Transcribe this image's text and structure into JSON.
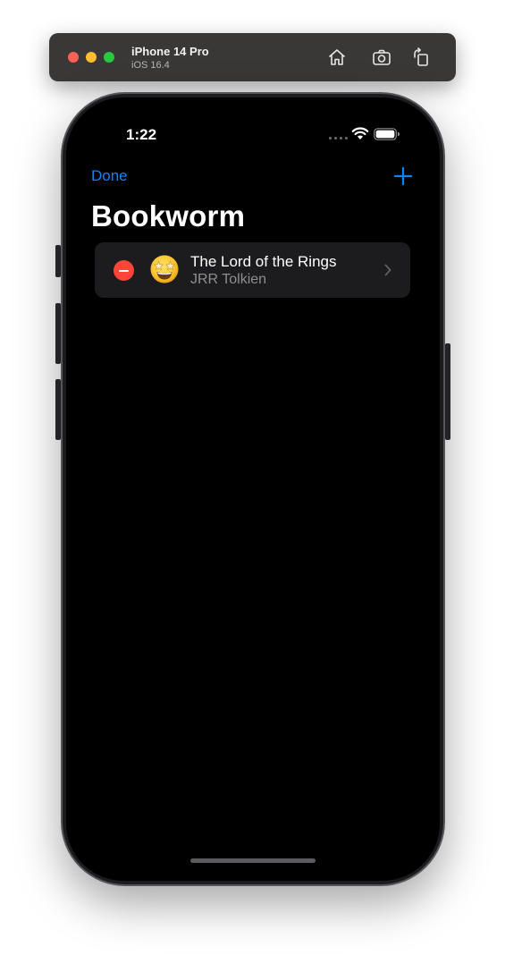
{
  "simulator": {
    "device_name": "iPhone 14 Pro",
    "os_version": "iOS 16.4",
    "toolbar_icons": [
      "home-icon",
      "screenshot-icon",
      "rotate-icon"
    ]
  },
  "status_bar": {
    "time": "1:22"
  },
  "nav": {
    "done_label": "Done",
    "title": "Bookworm",
    "add_icon": "plus-icon"
  },
  "books": [
    {
      "title": "The Lord of the Rings",
      "author": "JRR Tolkien",
      "rating_emoji": "star-struck-emoji"
    }
  ],
  "colors": {
    "accent": "#0a84ff",
    "delete": "#ff453a",
    "background": "#000000",
    "row_background": "#1c1c1e",
    "secondary_text": "#8e8e93"
  }
}
